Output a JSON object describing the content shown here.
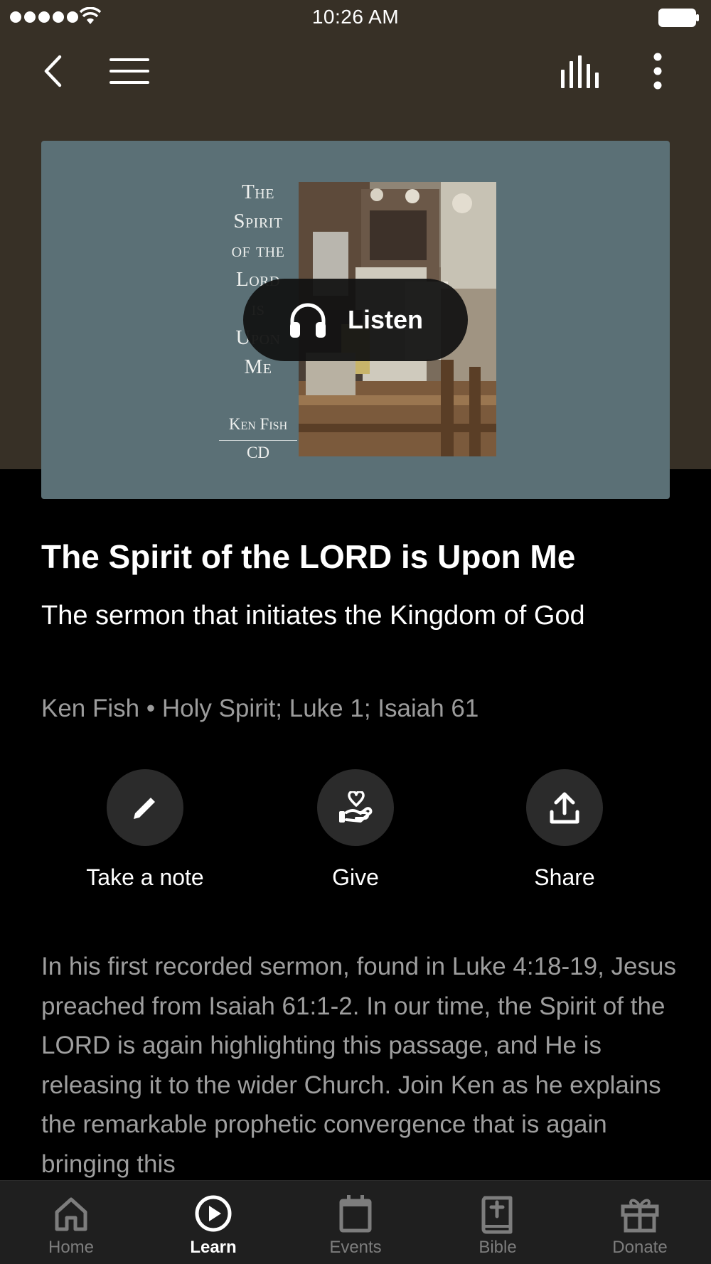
{
  "status_bar": {
    "time": "10:26 AM"
  },
  "nav": {
    "back_icon": "chevron-left-icon",
    "menu_icon": "hamburger-menu-icon",
    "playing_icon": "equalizer-icon",
    "more_icon": "more-vertical-icon"
  },
  "artwork": {
    "title_lines": [
      "The",
      "Spirit",
      "of the",
      "Lord",
      "is",
      "Upon",
      "Me"
    ],
    "author": "Ken Fish",
    "format": "CD",
    "listen_label": "Listen"
  },
  "sermon": {
    "title": "The Spirit of the LORD is Upon Me",
    "subtitle": "The sermon that initiates the Kingdom of God",
    "meta": "Ken Fish • Holy Spirit; Luke 1; Isaiah 61",
    "description": "In his first recorded sermon, found in Luke 4:18-19, Jesus preached from Isaiah 61:1-2. In our time, the Spirit of the LORD is again highlighting this passage, and He is releasing it to the wider Church. Join Ken as he explains the remarkable prophetic convergence that is again bringing this"
  },
  "actions": {
    "note": "Take a note",
    "give": "Give",
    "share": "Share"
  },
  "tabs": [
    {
      "label": "Home",
      "icon": "home-icon"
    },
    {
      "label": "Learn",
      "icon": "play-circle-icon"
    },
    {
      "label": "Events",
      "icon": "calendar-icon"
    },
    {
      "label": "Bible",
      "icon": "bible-icon"
    },
    {
      "label": "Donate",
      "icon": "gift-icon"
    }
  ],
  "colors": {
    "hero_background": "#373026",
    "artwork_background": "#5b7076",
    "tab_bar": "#1f1f1f",
    "active_tab": "#ffffff",
    "inactive_tab": "#7d7d7d"
  }
}
